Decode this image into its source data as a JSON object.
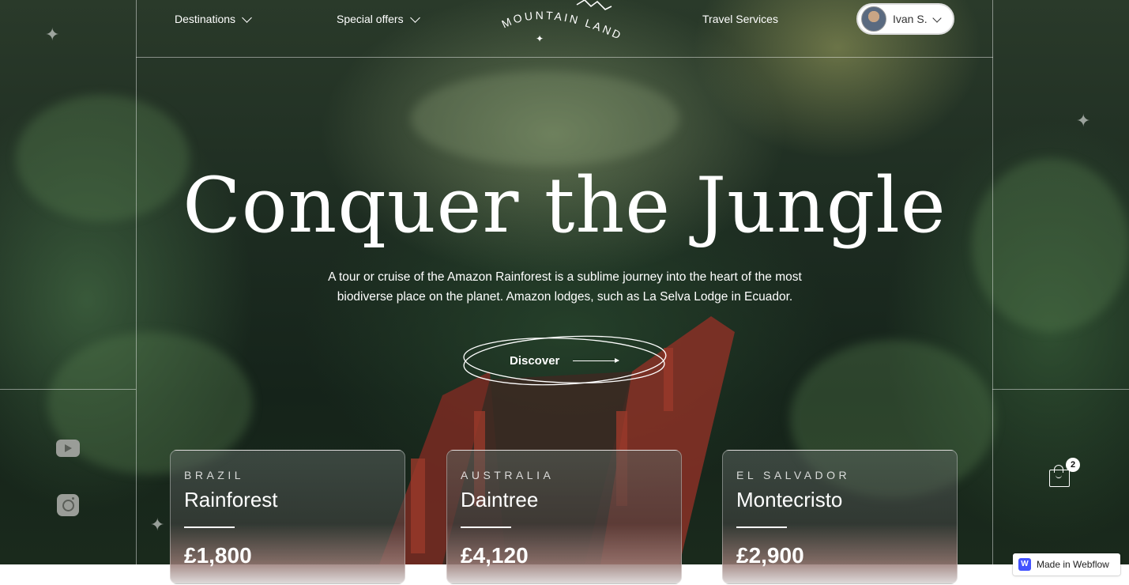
{
  "nav": {
    "destinations": "Destinations",
    "special_offers": "Special offers",
    "travel_services": "Travel Services",
    "logo_text": "MOUNTAIN LAND"
  },
  "user": {
    "name": "Ivan S."
  },
  "hero": {
    "headline": "Conquer the Jungle",
    "subtitle": "A tour or cruise of the Amazon Rainforest is a sublime journey into the heart of the most biodiverse place on the planet. Amazon lodges, such as La Selva Lodge in Ecuador.",
    "cta": "Discover"
  },
  "cards": [
    {
      "country": "BRAZIL",
      "name": "Rainforest",
      "price": "£1,800"
    },
    {
      "country": "AUSTRALIA",
      "name": "Daintree",
      "price": "£4,120"
    },
    {
      "country": "EL SALVADOR",
      "name": "Montecristo",
      "price": "£2,900"
    }
  ],
  "cart": {
    "count": "2"
  },
  "badge": {
    "text": "Made in Webflow",
    "icon": "W"
  },
  "social": {
    "youtube": "youtube-icon",
    "instagram": "instagram-icon"
  }
}
